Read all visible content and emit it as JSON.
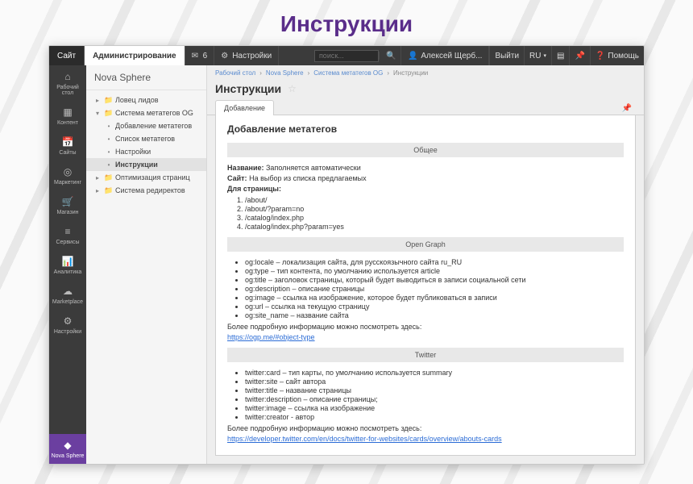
{
  "hero": "Инструкции",
  "topbar": {
    "site": "Сайт",
    "admin": "Администрирование",
    "notif_count": "6",
    "settings": "Настройки",
    "search_ph": "поиск...",
    "user": "Алексей Щерб...",
    "exit": "Выйти",
    "lang": "RU",
    "help": "Помощь"
  },
  "rail": {
    "items": [
      {
        "label": "Рабочий стол"
      },
      {
        "label": "Контент"
      },
      {
        "label": "Сайты"
      },
      {
        "label": "Маркетинг"
      },
      {
        "label": "Магазин"
      },
      {
        "label": "Сервисы"
      },
      {
        "label": "Аналитика"
      },
      {
        "label": "Marketplace"
      },
      {
        "label": "Настройки"
      },
      {
        "label": "Nova Sphere"
      }
    ]
  },
  "side": {
    "title": "Nova Sphere",
    "nodes": [
      {
        "label": "Ловец лидов"
      },
      {
        "label": "Система метатегов OG"
      },
      {
        "label": "Добавление метатегов",
        "child": true
      },
      {
        "label": "Список метатегов",
        "child": true
      },
      {
        "label": "Настройки",
        "child": true
      },
      {
        "label": "Инструкции",
        "child": true,
        "sel": true
      },
      {
        "label": "Оптимизация страниц"
      },
      {
        "label": "Система редиректов"
      }
    ]
  },
  "crumbs": [
    "Рабочий стол",
    "Nova Sphere",
    "Система метатегов OG",
    "Инструкции"
  ],
  "page_title": "Инструкции",
  "tab": "Добавление",
  "content": {
    "h2": "Добавление метатегов",
    "sec_general": "Общее",
    "name_lbl": "Название:",
    "name_val": "Заполняется автоматически",
    "site_lbl": "Сайт:",
    "site_val": "На выбор из списка предлагаемых",
    "page_lbl": "Для страницы:",
    "page_list": [
      "/about/",
      "/about/?param=no",
      "/catalog/index.php",
      "/catalog/index.php?param=yes"
    ],
    "sec_og": "Open Graph",
    "og_list": [
      "og:locale – локализация сайта, для русскоязычного сайта ru_RU",
      "og:type – тип контента, по умолчанию используется article",
      "og:title – заголовок страницы, который будет выводиться в записи социальной сети",
      "og:description – описание страницы",
      "og:image – ссылка на изображение, которое будет публиковаться в записи",
      "og:url – ссылка на текущую страницу",
      "og:site_name – название сайта"
    ],
    "og_more": "Более подробную информацию можно посмотреть здесь:",
    "og_link": "https://ogp.me/#object-type",
    "sec_tw": "Twitter",
    "tw_list": [
      "twitter:card – тип карты, по умолчанию используется summary",
      "twitter:site – сайт автора",
      "twitter:title – название страницы",
      "twitter:description – описание страницы;",
      "twitter:image – ссылка на изображение",
      "twitter:creator - автор"
    ],
    "tw_more": "Более подробную информацию можно посмотреть здесь:",
    "tw_link": "https://developer.twitter.com/en/docs/twitter-for-websites/cards/overview/abouts-cards"
  }
}
